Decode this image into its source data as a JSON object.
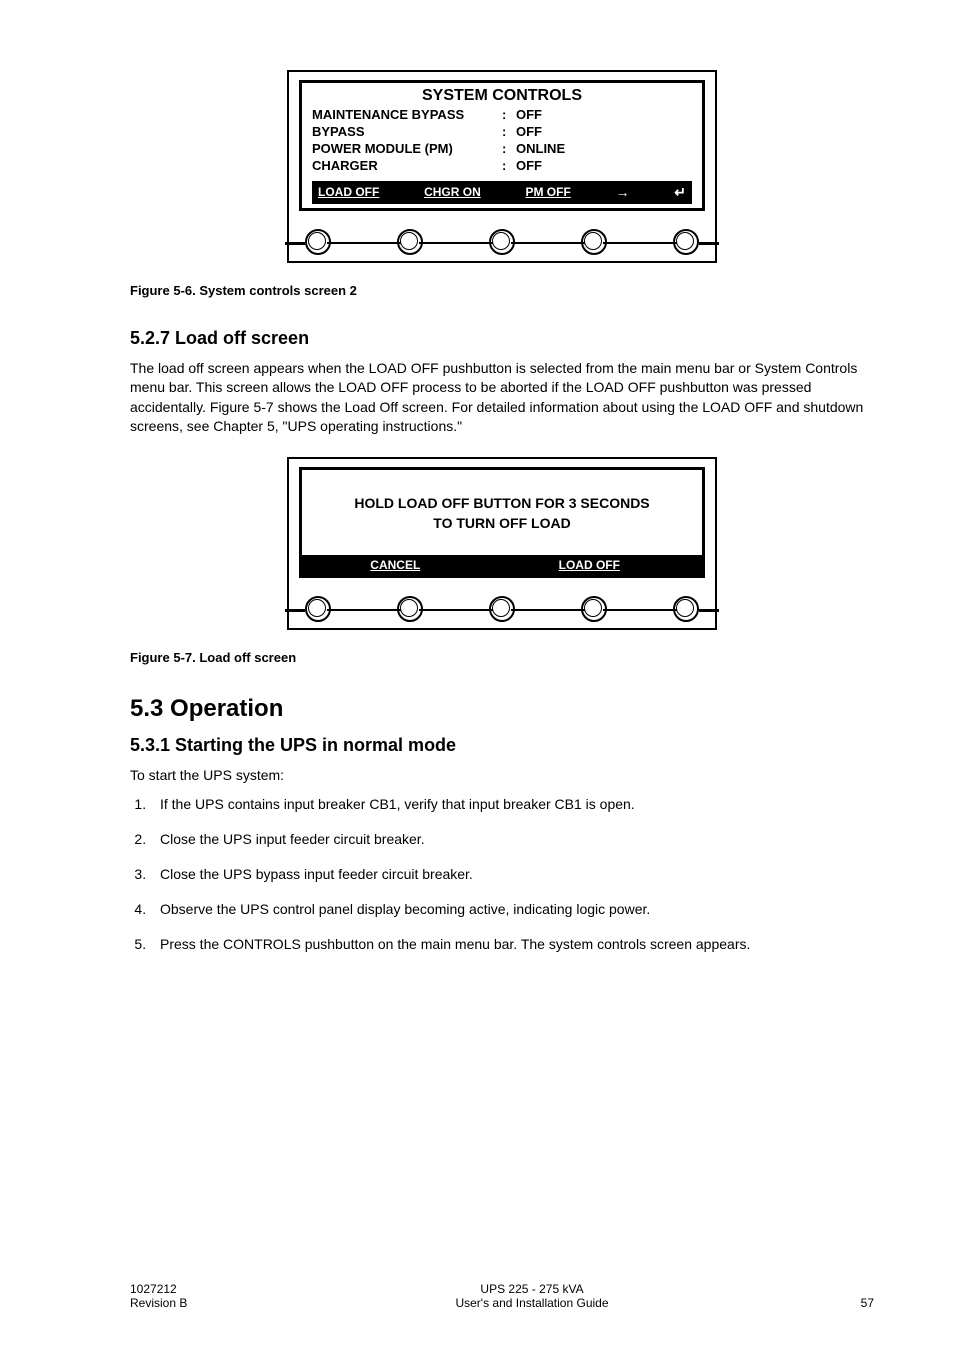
{
  "screen1": {
    "title": "SYSTEM CONTROLS",
    "rows": [
      {
        "label": "MAINTENANCE BYPASS",
        "value": "OFF"
      },
      {
        "label": "BYPASS",
        "value": "OFF"
      },
      {
        "label": "POWER MODULE (PM)",
        "value": "ONLINE"
      },
      {
        "label": "CHARGER",
        "value": "OFF"
      }
    ],
    "menu": [
      "LOAD OFF",
      "CHGR ON",
      "PM OFF"
    ]
  },
  "caption1": "Figure 5-6. System controls screen 2",
  "section527": {
    "heading": "5.2.7 Load off screen",
    "body": "The load off screen appears when the LOAD OFF pushbutton is selected from the main menu bar or System Controls menu bar. This screen allows the LOAD OFF process to be aborted if the LOAD OFF pushbutton was pressed accidentally. Figure 5-7 shows the Load Off screen. For detailed information about using the LOAD OFF and shutdown screens, see Chapter 5, \"UPS operating instructions.\""
  },
  "screen2": {
    "msg_line1": "HOLD LOAD OFF BUTTON FOR 3 SECONDS",
    "msg_line2": "TO TURN OFF LOAD",
    "menu_left": "CANCEL",
    "menu_right": "LOAD OFF"
  },
  "caption2": "Figure 5-7. Load off screen",
  "section53": {
    "heading": "5.3 Operation",
    "sub": "5.3.1 Starting the UPS in normal mode",
    "intro": "To start the UPS system:",
    "steps": [
      "If the UPS contains input breaker CB1, verify that input breaker CB1 is open.",
      "Close the UPS input feeder circuit breaker.",
      "Close the UPS bypass input feeder circuit breaker.",
      "Observe the UPS control panel display becoming active, indicating logic power.",
      "Press the CONTROLS pushbutton on the main menu bar. The system controls screen appears."
    ]
  },
  "footer": {
    "doc_num": "1027212",
    "revision": "Revision B",
    "title1": "UPS 225 - 275 kVA",
    "title2": "User's and Installation Guide",
    "page": "57"
  }
}
